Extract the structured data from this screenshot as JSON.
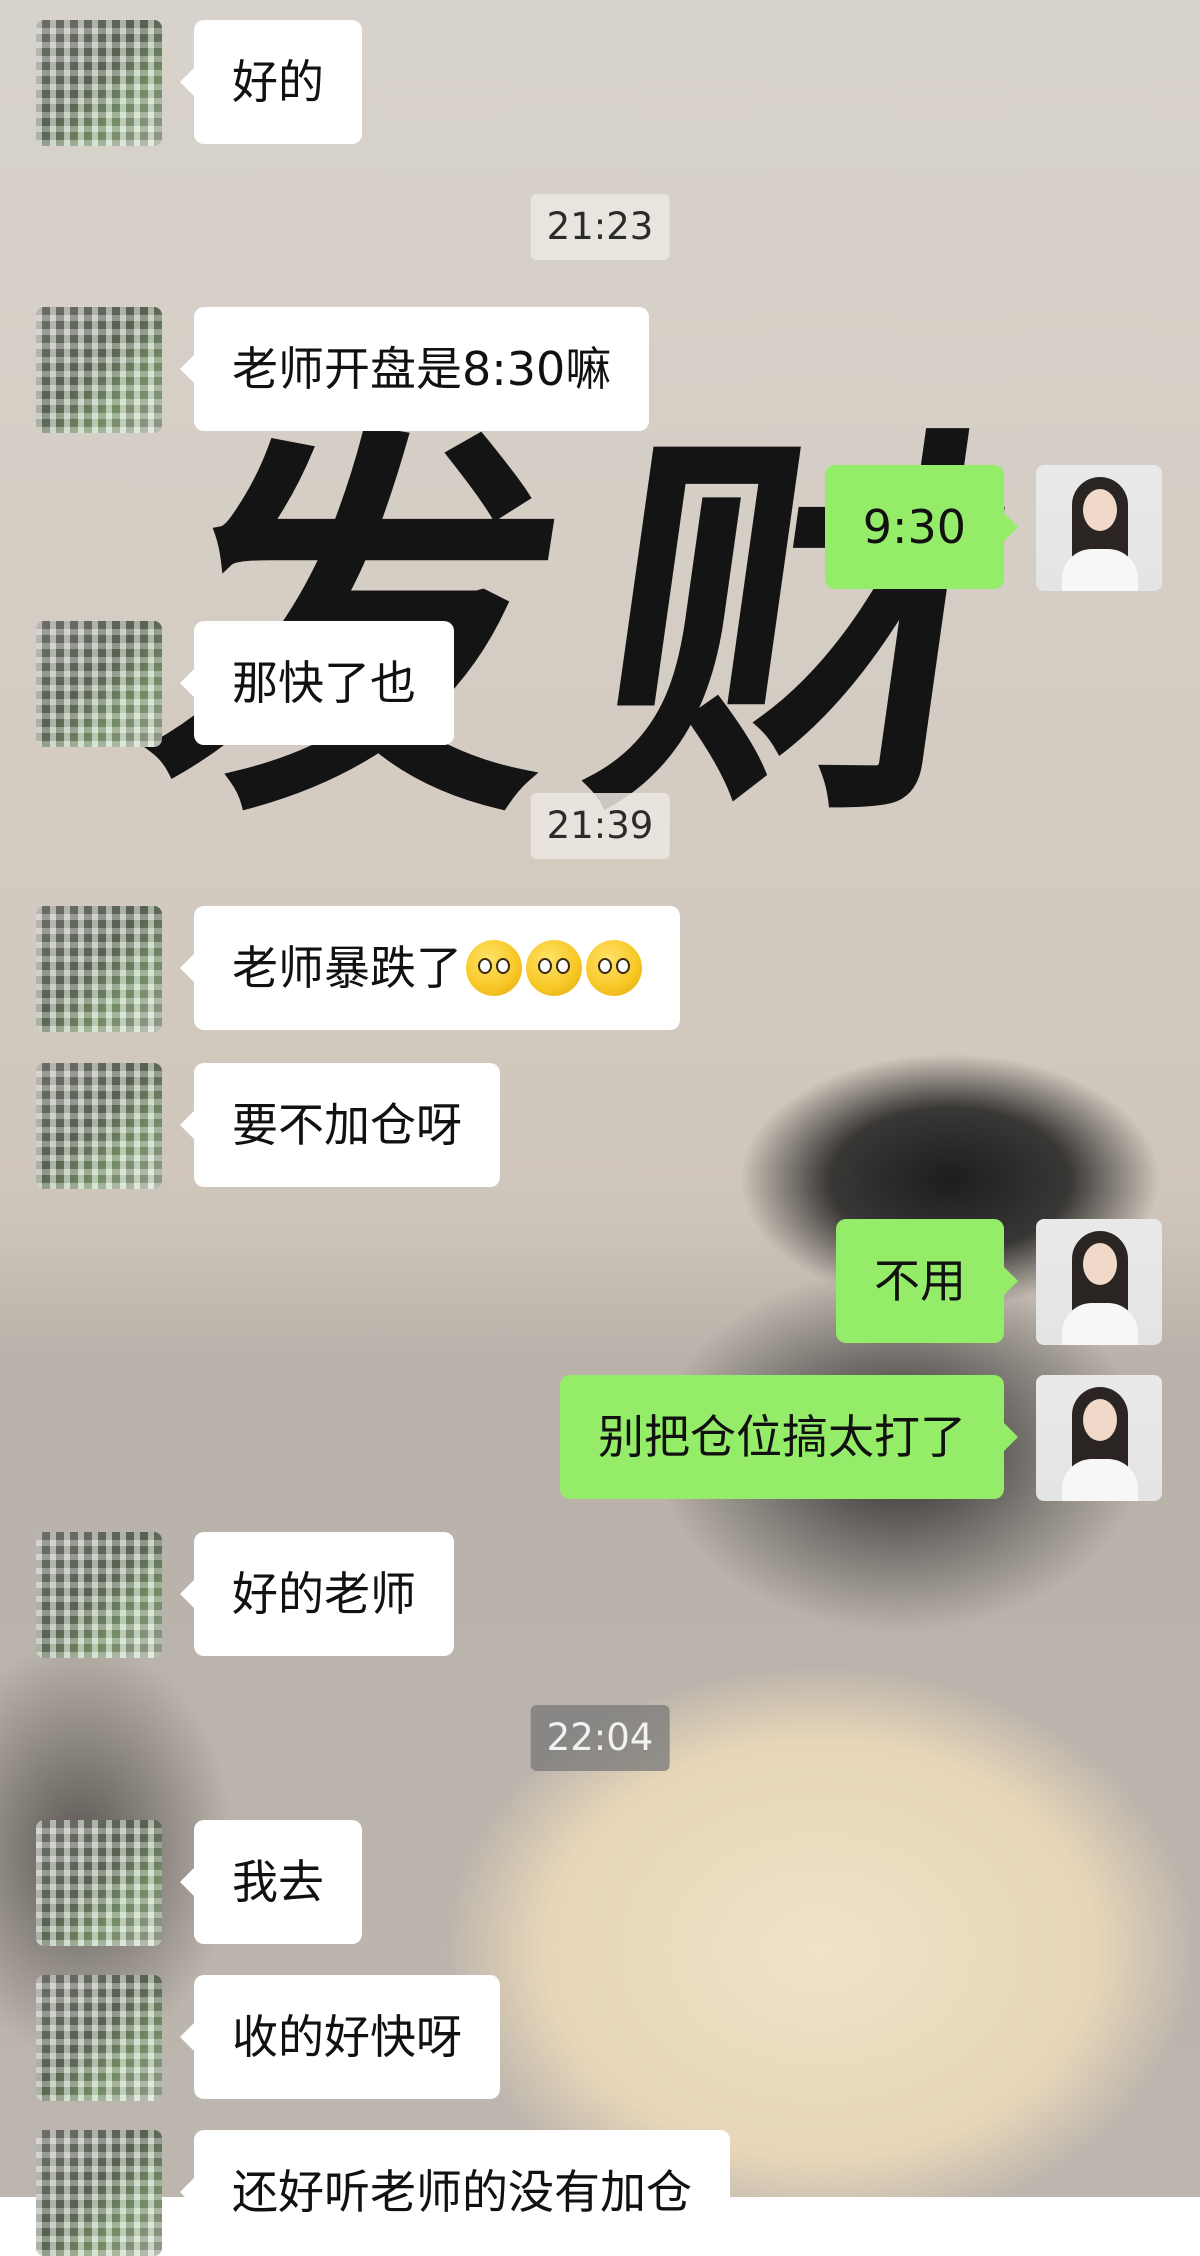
{
  "wallpaper": {
    "calligraphy": [
      "发",
      "财"
    ]
  },
  "colors": {
    "my_bubble": "#95ec69",
    "other_bubble": "#ffffff"
  },
  "messages": [
    {
      "type": "text",
      "from": "other",
      "text": "好的"
    },
    {
      "type": "time",
      "text": "21:23"
    },
    {
      "type": "text",
      "from": "other",
      "text": "老师开盘是8:30嘛"
    },
    {
      "type": "text",
      "from": "me",
      "text": "9:30"
    },
    {
      "type": "text",
      "from": "other",
      "text": "那快了也"
    },
    {
      "type": "time",
      "text": "21:39"
    },
    {
      "type": "text",
      "from": "other",
      "text": "老师暴跌了",
      "emoji": [
        "pleading-face",
        "pleading-face",
        "pleading-face"
      ]
    },
    {
      "type": "text",
      "from": "other",
      "text": "要不加仓呀"
    },
    {
      "type": "text",
      "from": "me",
      "text": "不用"
    },
    {
      "type": "text",
      "from": "me",
      "text": "别把仓位搞太打了"
    },
    {
      "type": "text",
      "from": "other",
      "text": "好的老师"
    },
    {
      "type": "time",
      "text": "22:04"
    },
    {
      "type": "text",
      "from": "other",
      "text": "我去"
    },
    {
      "type": "text",
      "from": "other",
      "text": "收的好快呀"
    },
    {
      "type": "text",
      "from": "other",
      "text": "还好听老师的没有加仓"
    }
  ]
}
